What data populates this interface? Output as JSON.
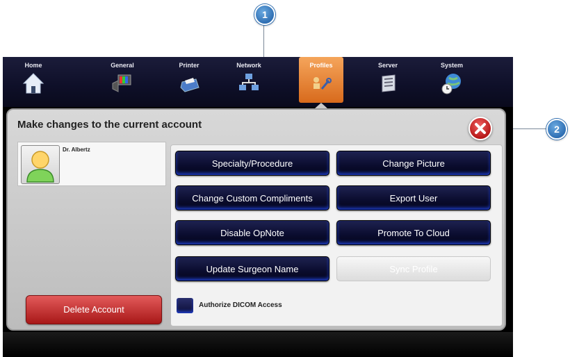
{
  "callouts": [
    "1",
    "2"
  ],
  "tabs": [
    {
      "label": "Home",
      "icon": "home-icon"
    },
    {
      "label": "General",
      "icon": "monitor-speaker-icon"
    },
    {
      "label": "Printer",
      "icon": "printer-icon"
    },
    {
      "label": "Network",
      "icon": "network-icon"
    },
    {
      "label": "Profiles",
      "icon": "profiles-tools-icon",
      "active": true
    },
    {
      "label": "Server",
      "icon": "server-icon"
    },
    {
      "label": "System",
      "icon": "globe-clock-icon"
    }
  ],
  "panel": {
    "title": "Make changes to the current account",
    "user_name": "Dr. Albertz",
    "delete_label": "Delete Account",
    "authorize_label": "Authorize DICOM Access"
  },
  "actions": [
    {
      "label": "Specialty/Procedure"
    },
    {
      "label": "Change Picture"
    },
    {
      "label": "Change Custom Compliments"
    },
    {
      "label": "Export User"
    },
    {
      "label": "Disable OpNote"
    },
    {
      "label": "Promote To Cloud"
    },
    {
      "label": "Update Surgeon Name"
    },
    {
      "label": "Sync Profile",
      "disabled": true
    }
  ],
  "colors": {
    "active_tab": "#e98b36",
    "action_button": "#0a0c2e",
    "delete_button": "#c62f2f",
    "close_button": "#d42a2a",
    "callout": "#2f6fb3"
  }
}
